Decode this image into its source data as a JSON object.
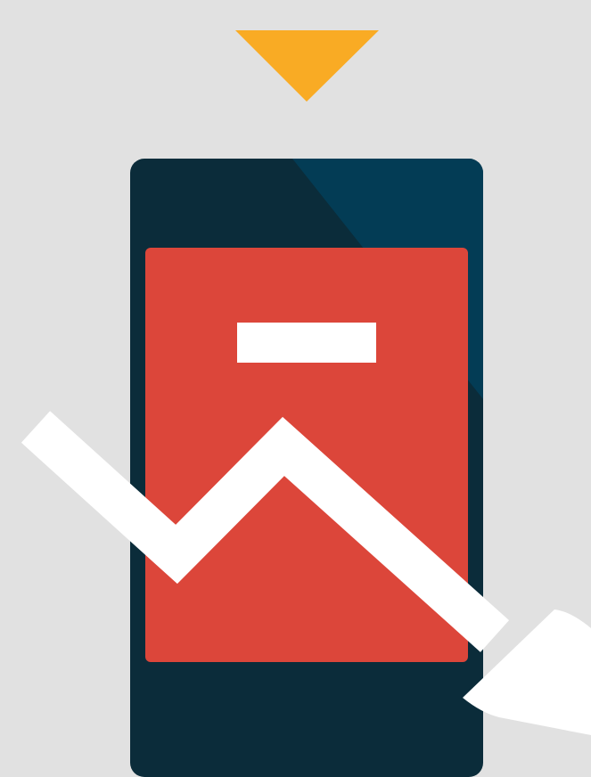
{
  "colors": {
    "background": "#e1e1e1",
    "indicator": "#f9ab24",
    "phone_body": "#0b2c3a",
    "phone_glare": "#033c55",
    "screen": "#dc463a",
    "screen_bar": "#ffffff",
    "trend_arrow": "#ffffff"
  },
  "icons": {
    "indicator": "triangle-down-icon",
    "device": "smartphone-icon",
    "trend": "trend-down-arrow-icon",
    "screen_bar": "minus-icon"
  }
}
